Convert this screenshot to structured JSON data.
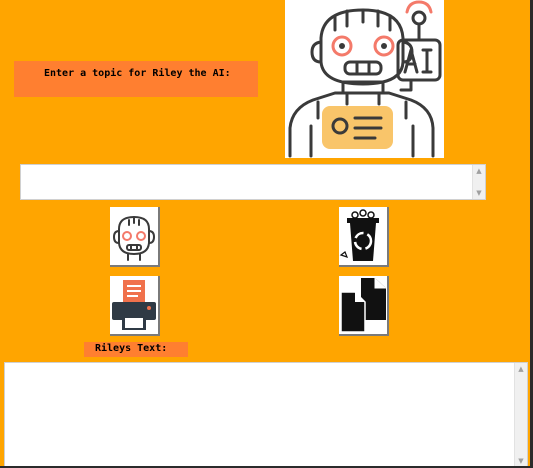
{
  "window": {
    "background": "#FFA500",
    "label_background": "#FF7F30"
  },
  "prompt": {
    "label": "Enter a topic for Riley the AI:"
  },
  "logo": {
    "icon": "robot-ai-icon"
  },
  "topic_input": {
    "value": "",
    "scroll_up": "▲",
    "scroll_down": "▼"
  },
  "buttons": {
    "generate": {
      "icon": "robot-head-icon"
    },
    "clear": {
      "icon": "recycle-bin-icon"
    },
    "print": {
      "icon": "printer-icon"
    },
    "copy": {
      "icon": "copy-documents-icon"
    }
  },
  "output": {
    "label": "Rileys Text:",
    "value": "",
    "scroll_up": "▲",
    "scroll_down": "▼"
  }
}
